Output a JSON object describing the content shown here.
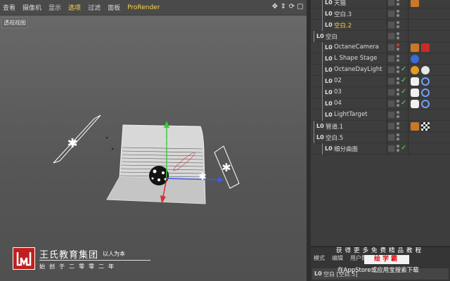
{
  "menu": {
    "items": [
      "查看",
      "摄像机",
      "显示",
      "选项",
      "过滤",
      "面板",
      "ProRender"
    ],
    "active_index": 3
  },
  "viewport": {
    "label": "透视视图",
    "nav_icons": [
      "move-icon",
      "zoom-icon",
      "rotate-icon",
      "maximize-icon"
    ]
  },
  "objects": [
    {
      "name": "天猫",
      "indent": 1,
      "color": "white",
      "tags": [
        "orange"
      ]
    },
    {
      "name": "空白.3",
      "indent": 1,
      "color": "white",
      "tags": []
    },
    {
      "name": "空白.2",
      "indent": 1,
      "color": "yellow",
      "tags": []
    },
    {
      "name": "空白",
      "indent": 0,
      "color": "white",
      "tags": []
    },
    {
      "name": "OctaneCamera",
      "indent": 1,
      "color": "white",
      "tags": [
        "orange",
        "red"
      ]
    },
    {
      "name": "L Shape Stage",
      "indent": 1,
      "color": "white",
      "tags": [
        "blue"
      ]
    },
    {
      "name": "OctaneDayLight",
      "indent": 1,
      "color": "white",
      "tags": [
        "sun",
        "white"
      ]
    },
    {
      "name": "02",
      "indent": 1,
      "color": "white",
      "tags": [
        "bulb",
        "circle"
      ]
    },
    {
      "name": "03",
      "indent": 1,
      "color": "white",
      "tags": [
        "bulb",
        "circle"
      ]
    },
    {
      "name": "04",
      "indent": 1,
      "color": "white",
      "tags": [
        "bulb",
        "circle"
      ]
    },
    {
      "name": "LightTarget",
      "indent": 1,
      "color": "white",
      "tags": []
    },
    {
      "name": "管道.1",
      "indent": 0,
      "color": "white",
      "tags": [
        "orange",
        "check"
      ]
    },
    {
      "name": "空白.5",
      "indent": 0,
      "color": "white",
      "tags": []
    },
    {
      "name": "细分曲面",
      "indent": 1,
      "color": "white",
      "tags": []
    }
  ],
  "attributes": {
    "tabs": [
      "模式",
      "编辑",
      "用户数据"
    ],
    "object_name": "空白 [空白.5]"
  },
  "brand": {
    "name": "王氏教育集团",
    "motto": "以人为本",
    "since": "始创于二零零二年"
  },
  "promo": {
    "line1": "获得更多免费精品教程",
    "badge": "绘学霸",
    "line2": "在AppStore或应用宝搜索下载"
  },
  "colors": {
    "active_menu": "#ffd54a",
    "brand_red": "#c01f1f",
    "axis_x": "#d83030",
    "axis_y": "#3ccd3c",
    "axis_z": "#3a5cf0"
  }
}
